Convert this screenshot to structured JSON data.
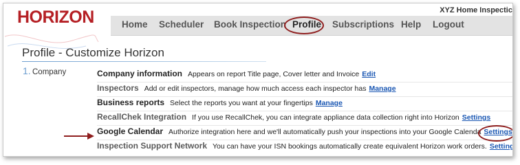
{
  "app": {
    "logo": "HORIZON",
    "company_name": "XYZ Home Inspectic"
  },
  "nav": {
    "items": [
      {
        "label": "Home"
      },
      {
        "label": "Scheduler"
      },
      {
        "label": "Book Inspection"
      },
      {
        "label": "Profile"
      },
      {
        "label": "Subscriptions"
      },
      {
        "label": "Help"
      },
      {
        "label": "Logout"
      }
    ],
    "active": "Profile"
  },
  "page": {
    "title": "Profile - Customize Horizon"
  },
  "sidebar": {
    "number": "1.",
    "label": "Company"
  },
  "rows": [
    {
      "name": "Company information",
      "desc": "Appears on report Title page, Cover letter and Invoice",
      "link": "Edit"
    },
    {
      "name": "Inspectors",
      "desc": "Add or edit inspectors, manage how much access each inspector has",
      "link": "Manage"
    },
    {
      "name": "Business reports",
      "desc": "Select the reports you want at your fingertips",
      "link": "Manage"
    },
    {
      "name": "RecallChek Integration",
      "desc": "If you use RecallChek, you can integrate appliance data collection right into Horizon",
      "link": "Settings"
    },
    {
      "name": "Google Calendar",
      "desc": "Authorize integration here and we'll automatically push your inspections into your Google Calenda",
      "link": "Settings"
    },
    {
      "name": "Inspection Support Network",
      "desc": "You can have your ISN bookings automatically create equivalent Horizon work orders.",
      "link": "Settings"
    }
  ],
  "colors": {
    "brand": "#b51f24",
    "link": "#1a57b3",
    "annotation": "#8f1f1f",
    "nav_bg": "#e3e3e3"
  }
}
